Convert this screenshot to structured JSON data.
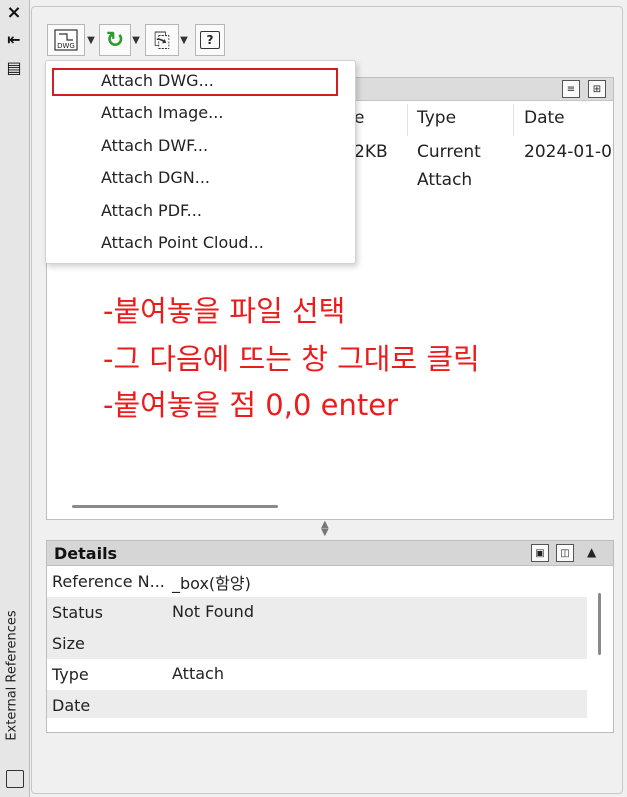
{
  "palette": {
    "highlight_border": "#d11f1f",
    "annotation_text": "#ea1c1c"
  },
  "sidebar": {
    "close_icon": "×",
    "collapse_icon": "⇤",
    "properties_icon": "▤",
    "vertical_title": "External References"
  },
  "toolbar": {
    "attach_dwg_icon_label": "DWG",
    "refresh_icon": "↻",
    "change_path_icon": "⎘",
    "help_icon": "?"
  },
  "menu": {
    "items": [
      "Attach DWG...",
      "Attach Image...",
      "Attach DWF...",
      "Attach DGN...",
      "Attach PDF...",
      "Attach Point Cloud..."
    ],
    "selected_index": 0
  },
  "file_list": {
    "columns": [
      "e",
      "Type",
      "Date"
    ],
    "row": {
      "size_fragment": "2KB",
      "type_line1": "Current",
      "type_line2": "Attach",
      "date_fragment": "2024-01-0"
    }
  },
  "annotation": {
    "lines": [
      "-붙여놓을 파일 선택",
      "-그 다음에 뜨는 창 그대로 클릭",
      "-붙여놓을 점 0,0 enter"
    ]
  },
  "details": {
    "title": "Details",
    "rows": [
      {
        "label": "Reference N...",
        "value": "_box(함양)"
      },
      {
        "label": "Status",
        "value": "Not Found"
      },
      {
        "label": "Size",
        "value": ""
      },
      {
        "label": "Type",
        "value": "Attach"
      },
      {
        "label": "Date",
        "value": ""
      }
    ]
  }
}
